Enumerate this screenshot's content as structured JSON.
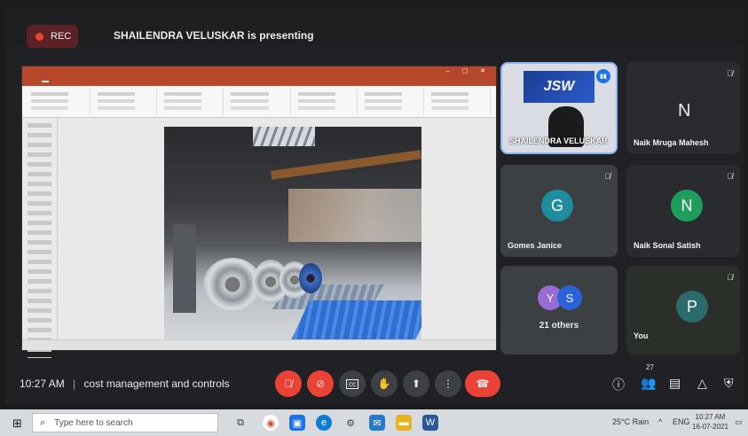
{
  "meet": {
    "rec_label": "REC",
    "presenting_text": "SHAILENDRA VELUSKAR is presenting",
    "presenter_tile": {
      "logo_text": "JSW",
      "name": "SHAILENDRA VELUSKAR"
    },
    "participants": [
      {
        "name": "Naik Mruga Mahesh",
        "initial": "N",
        "muted": true
      },
      {
        "name": "Gomes Janice",
        "initial": "G",
        "muted": true,
        "avatar_color": "#1e8e9e"
      },
      {
        "name": "Naik Sonal Satish",
        "initial": "N",
        "muted": true,
        "avatar_color": "#1e9e5a"
      },
      {
        "name": "You",
        "initial": "P",
        "muted": true,
        "avatar_color": "#2b6b6b"
      }
    ],
    "others_tile": {
      "label": "21 others",
      "avatars": [
        "Y",
        "S"
      ]
    },
    "bottom_bar": {
      "time": "10:27 AM",
      "separator": "|",
      "meeting_title": "cost management and controls",
      "participant_count": "27"
    }
  },
  "taskbar": {
    "search_placeholder": "Type here to search",
    "weather": "25°C Rain",
    "language": "ENG",
    "time": "10:27 AM",
    "date": "16-07-2021"
  }
}
